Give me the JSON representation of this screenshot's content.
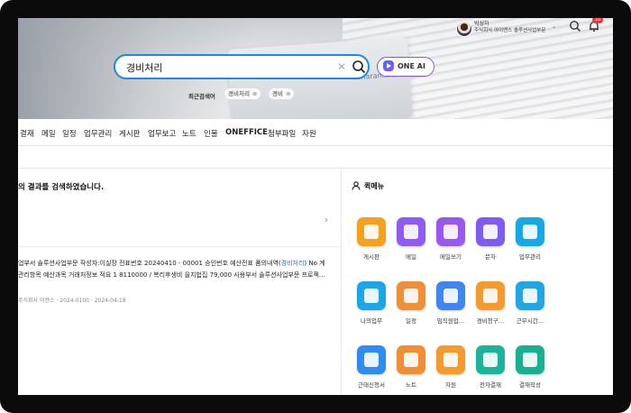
{
  "header": {
    "user_name": "박성하",
    "user_org": "주식회사 아이엔스 솔루션사업부문",
    "notification_count": "10"
  },
  "search": {
    "value": "경비처리",
    "ai_button": "ONE AI",
    "recent_label": "최근검색어",
    "recent": [
      "경비처리",
      "경비"
    ]
  },
  "hero": {
    "laptop_text": "Amaranth 10"
  },
  "nav": {
    "items": [
      "결재",
      "메일",
      "일정",
      "업무관리",
      "게시판",
      "업무보고",
      "노트",
      "인물",
      "ONEFFICE",
      "첨부파일",
      "자원"
    ]
  },
  "results": {
    "title": "의 결과를 검색하였습니다.",
    "line1_pre": "업부서 솔루션사업부문 작성자:이실장 전표번호 20240410 - 00001 승인번호 예산전표 품의내역(",
    "line1_hl": "경비처리",
    "line1_post": ") No 계",
    "line2": "관리항목 예산과목 거래처정보 적요 1 8110000 / 복리후생비 을지법집 79,000 사용부서 솔루션사업부문 프로젝…",
    "meta": "주식회사 이엔스 · 2024-0100 · 2024-04-18"
  },
  "quick_menu": {
    "title": "퀵메뉴",
    "items": [
      {
        "label": "게시판",
        "icon": "board-icon",
        "color": "#f4a21d"
      },
      {
        "label": "메일",
        "icon": "mail-icon",
        "color": "#8e5cf5"
      },
      {
        "label": "메일쓰기",
        "icon": "mail-write-icon",
        "color": "#9b57f2"
      },
      {
        "label": "문자",
        "icon": "sms-icon",
        "color": "#7c5cf3"
      },
      {
        "label": "업무관리",
        "icon": "kiss-icon",
        "color": "#17a9e6"
      },
      {
        "label": "나의업무",
        "icon": "my-task-icon",
        "color": "#1ba6e8"
      },
      {
        "label": "일정",
        "icon": "calendar-icon",
        "color": "#f08f3a"
      },
      {
        "label": "임직원업…",
        "icon": "employee-icon",
        "color": "#3f86f0"
      },
      {
        "label": "경비청구…",
        "icon": "expense-icon",
        "color": "#f59a2e"
      },
      {
        "label": "근무시간…",
        "icon": "work-time-icon",
        "color": "#20a7e4"
      },
      {
        "label": "근태신청서",
        "icon": "attendance-icon",
        "color": "#2f8cf2"
      },
      {
        "label": "노트",
        "icon": "note-icon",
        "color": "#f18e34"
      },
      {
        "label": "자원",
        "icon": "resource-icon",
        "color": "#f59b2d"
      },
      {
        "label": "전자결재",
        "icon": "approval-icon",
        "color": "#1bb39a"
      },
      {
        "label": "결재작성",
        "icon": "approval-write-icon",
        "color": "#18b08f"
      }
    ]
  },
  "colors": {
    "accent": "#1e88e5",
    "ai_border": "#8b4ff0",
    "highlight": "#1e6fd9"
  }
}
